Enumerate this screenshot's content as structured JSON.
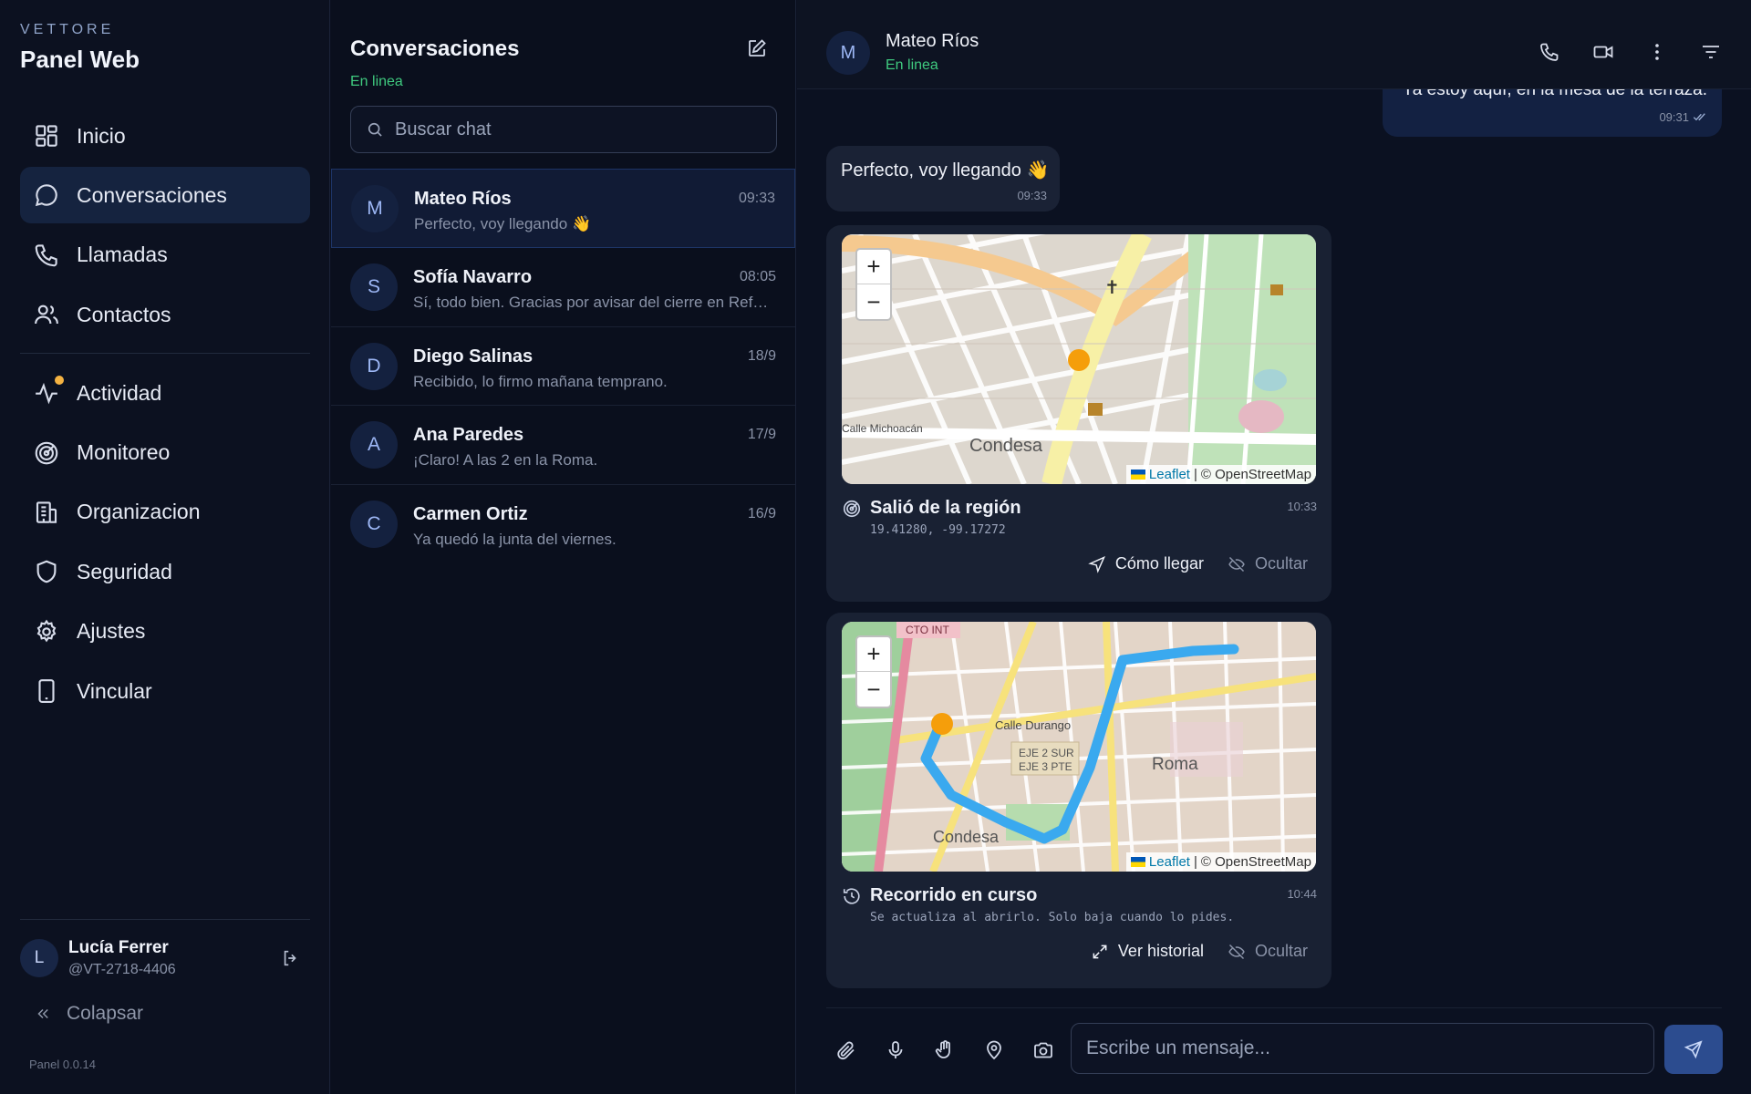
{
  "brand": {
    "kicker": "VETTORE",
    "title": "Panel Web"
  },
  "nav": {
    "primary": [
      {
        "label": "Inicio",
        "icon": "grid-icon"
      },
      {
        "label": "Conversaciones",
        "icon": "chat-icon",
        "active": true
      },
      {
        "label": "Llamadas",
        "icon": "phone-icon"
      },
      {
        "label": "Contactos",
        "icon": "users-icon"
      }
    ],
    "secondary": [
      {
        "label": "Actividad",
        "icon": "activity-icon",
        "badge": true
      },
      {
        "label": "Monitoreo",
        "icon": "radar-icon"
      },
      {
        "label": "Organizacion",
        "icon": "building-icon"
      },
      {
        "label": "Seguridad",
        "icon": "shield-icon"
      },
      {
        "label": "Ajustes",
        "icon": "gear-icon"
      },
      {
        "label": "Vincular",
        "icon": "device-icon"
      }
    ]
  },
  "user": {
    "initial": "L",
    "name": "Lucía Ferrer",
    "handle": "@VT-2718-4406"
  },
  "collapse_label": "Colapsar",
  "version": "Panel 0.0.14",
  "conversations": {
    "title": "Conversaciones",
    "status": "En linea",
    "search_placeholder": "Buscar chat",
    "items": [
      {
        "initial": "M",
        "name": "Mateo Ríos",
        "preview": "Perfecto, voy llegando 👋",
        "time": "09:33",
        "active": true
      },
      {
        "initial": "S",
        "name": "Sofía Navarro",
        "preview": "Sí, todo bien. Gracias por avisar del cierre en Reforma.",
        "time": "08:05"
      },
      {
        "initial": "D",
        "name": "Diego Salinas",
        "preview": "Recibido, lo firmo mañana temprano.",
        "time": "18/9"
      },
      {
        "initial": "A",
        "name": "Ana Paredes",
        "preview": "¡Claro! A las 2 en la Roma.",
        "time": "17/9"
      },
      {
        "initial": "C",
        "name": "Carmen Ortiz",
        "preview": "Ya quedó la junta del viernes.",
        "time": "16/9"
      }
    ]
  },
  "chat": {
    "contact": {
      "initial": "M",
      "name": "Mateo Ríos",
      "status": "En linea"
    },
    "outgoing": {
      "text": "Ya estoy aquí, en la mesa de la terraza.",
      "time": "09:31"
    },
    "incoming": {
      "text": "Perfecto, voy llegando 👋",
      "time": "09:33"
    },
    "cards": [
      {
        "title": "Salió de la región",
        "subtitle": "19.41280, -99.17272",
        "time": "10:33",
        "icon": "radar-icon",
        "map_labels": {
          "neighborhood": "Condesa",
          "street": "Calle Michoacán"
        },
        "actions": [
          {
            "label": "Cómo llegar",
            "icon": "navigation-icon",
            "style": "primary"
          },
          {
            "label": "Ocultar",
            "icon": "eye-off-icon",
            "style": "muted"
          }
        ]
      },
      {
        "title": "Recorrido en curso",
        "subtitle": "Se actualiza al abrirlo. Solo baja cuando lo pides.",
        "time": "10:44",
        "icon": "history-icon",
        "map_labels": {
          "neighborhood_a": "Roma",
          "neighborhood_b": "Condesa",
          "street": "Calle Durango",
          "axis_line_1": "EJE 2 SUR",
          "axis_line_2": "EJE 3 PTE",
          "tag": "CTO INT"
        },
        "actions": [
          {
            "label": "Ver historial",
            "icon": "expand-icon",
            "style": "primary"
          },
          {
            "label": "Ocultar",
            "icon": "eye-off-icon",
            "style": "muted"
          }
        ]
      }
    ],
    "map_attribution": {
      "leaflet": "Leaflet",
      "separator": "|",
      "osm": "© OpenStreetMap"
    },
    "zoom": {
      "in": "+",
      "out": "−"
    },
    "composer_placeholder": "Escribe un mensaje..."
  },
  "colors": {
    "accent": "#2c4c8f",
    "online": "#3fca7f",
    "badge": "#f5b342",
    "route": "#3aa9ef",
    "marker": "#f59e0b"
  }
}
